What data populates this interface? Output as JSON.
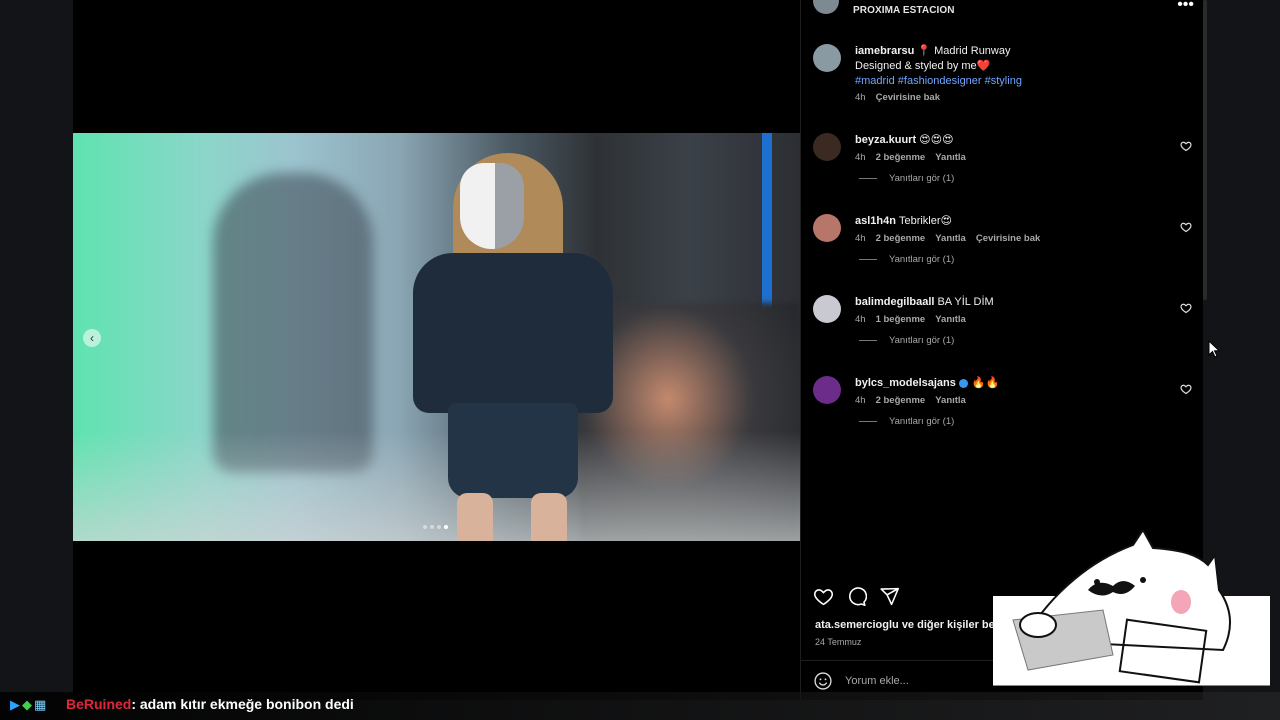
{
  "post": {
    "header_subtitle": "PROXIMA ESTACION",
    "more_icon": "more-horizontal-icon",
    "caption": {
      "user": "iamebrarsu",
      "line1": "📍 Madrid Runway",
      "line2": "Designed & styled by me❤️",
      "tags": "#madrid #fashiondesigner #styling",
      "time": "4h",
      "translate": "Çevirisine bak"
    },
    "comments": [
      {
        "user": "beyza.kuurt",
        "text": "😍😍😍",
        "time": "4h",
        "likes": "2 beğenme",
        "reply": "Yanıtla",
        "translate": "",
        "replies": "Yanıtları gör (1)",
        "avatar_color": "#3b2a22"
      },
      {
        "user": "asl1h4n",
        "text": "Tebrikler😍",
        "time": "4h",
        "likes": "2 beğenme",
        "reply": "Yanıtla",
        "translate": "Çevirisine bak",
        "replies": "Yanıtları gör (1)",
        "avatar_color": "#b8766a"
      },
      {
        "user": "balimdegilbaall",
        "text": "BA YİL DİM",
        "time": "4h",
        "likes": "1 beğenme",
        "reply": "Yanıtla",
        "translate": "",
        "replies": "Yanıtları gör (1)",
        "avatar_color": "#c9c9d2"
      },
      {
        "user": "bylcs_modelsajans",
        "text": "🔥🔥",
        "time": "4h",
        "likes": "2 beğenme",
        "reply": "Yanıtla",
        "translate": "",
        "replies": "Yanıtları gör (1)",
        "avatar_color": "#6b2c8a"
      }
    ],
    "likes_text": "ata.semercioglu ve diğer kişiler beğ",
    "date": "24 Temmuz",
    "comment_placeholder": "Yorum ekle..."
  },
  "stream": {
    "chat_user": "BeRuined",
    "chat_message": ": adam kıtır ekmeğe bonibon dedi"
  },
  "colors": {
    "hashtag": "#6fa6ff",
    "chat_user": "#e0263a",
    "verified": "#3897f0"
  }
}
